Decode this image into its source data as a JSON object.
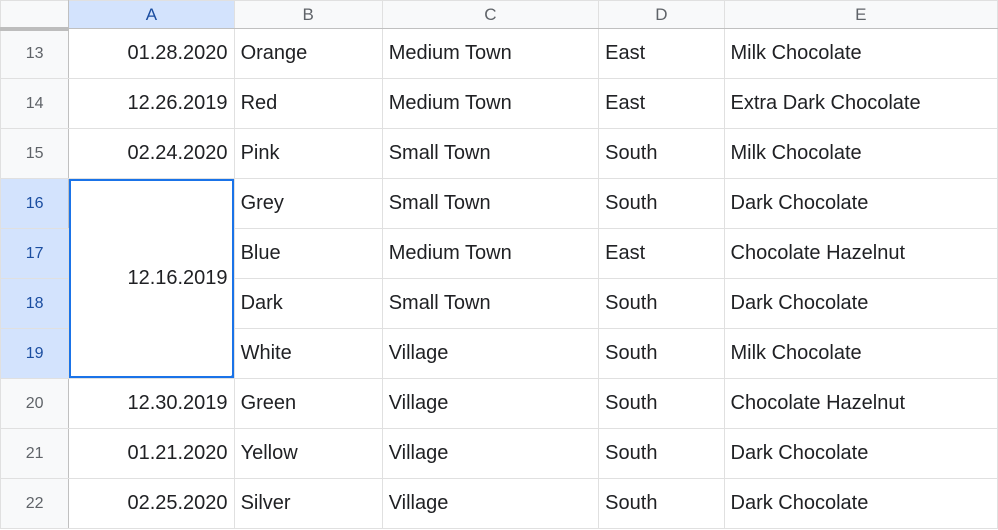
{
  "columns": [
    "A",
    "B",
    "C",
    "D",
    "E"
  ],
  "active_column": "A",
  "row_numbers": [
    13,
    14,
    15,
    16,
    17,
    18,
    19,
    20,
    21,
    22
  ],
  "active_rows": [
    16,
    17,
    18,
    19
  ],
  "merged_cell": {
    "col": "A",
    "rows": [
      16,
      17,
      18,
      19
    ],
    "value": "12.16.2019"
  },
  "rows": [
    {
      "n": 13,
      "A": "01.28.2020",
      "B": "Orange",
      "C": "Medium Town",
      "D": "East",
      "E": "Milk Chocolate"
    },
    {
      "n": 14,
      "A": "12.26.2019",
      "B": "Red",
      "C": "Medium Town",
      "D": "East",
      "E": "Extra Dark Chocolate"
    },
    {
      "n": 15,
      "A": "02.24.2020",
      "B": "Pink",
      "C": "Small Town",
      "D": "South",
      "E": "Milk Chocolate"
    },
    {
      "n": 16,
      "A": "12.16.2019",
      "B": "Grey",
      "C": "Small Town",
      "D": "South",
      "E": "Dark Chocolate"
    },
    {
      "n": 17,
      "A": "",
      "B": "Blue",
      "C": "Medium Town",
      "D": "East",
      "E": "Chocolate Hazelnut"
    },
    {
      "n": 18,
      "A": "",
      "B": "Dark",
      "C": "Small Town",
      "D": "South",
      "E": "Dark Chocolate"
    },
    {
      "n": 19,
      "A": "",
      "B": "White",
      "C": "Village",
      "D": "South",
      "E": "Milk Chocolate"
    },
    {
      "n": 20,
      "A": "12.30.2019",
      "B": "Green",
      "C": "Village",
      "D": "South",
      "E": "Chocolate Hazelnut"
    },
    {
      "n": 21,
      "A": "01.21.2020",
      "B": "Yellow",
      "C": "Village",
      "D": "South",
      "E": "Dark Chocolate"
    },
    {
      "n": 22,
      "A": "02.25.2020",
      "B": "Silver",
      "C": "Village",
      "D": "South",
      "E": "Dark Chocolate"
    }
  ]
}
